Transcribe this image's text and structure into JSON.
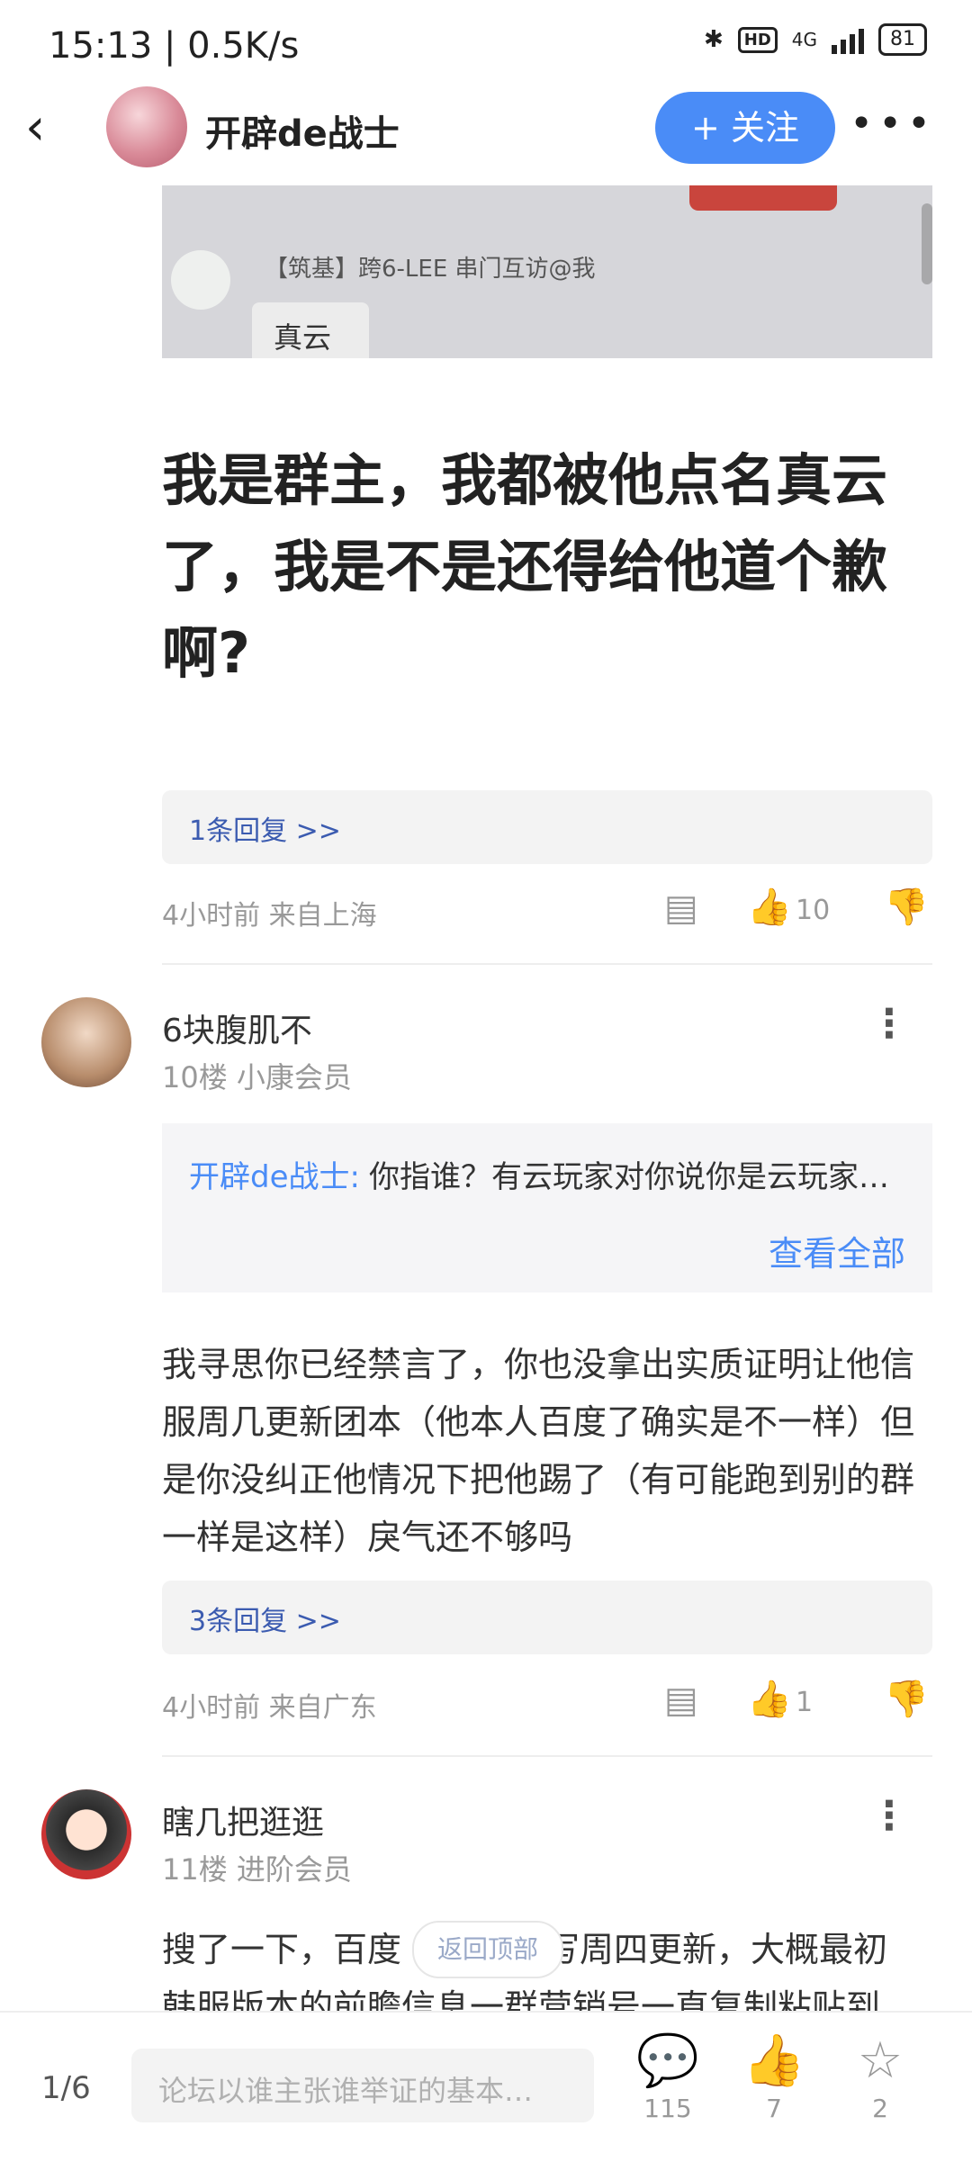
{
  "status": {
    "time": "15:13 | 0.5K/s",
    "bluetooth": "✱",
    "hd": "HD",
    "network": "4G",
    "battery": "81"
  },
  "header": {
    "author": "开辟de战士",
    "follow": "+ 关注"
  },
  "embed": {
    "text": "【筑基】跨6-LEE 串门互访@我",
    "bubble": "真云"
  },
  "post": {
    "title": "我是群主，我都被他点名真云了，我是不是还得给他道个歉啊?",
    "replies_link": "1条回复 >>",
    "meta": "4小时前 来自上海",
    "likes": "10"
  },
  "floor10": {
    "name": "6块腹肌不",
    "sub": "10楼 小康会员",
    "quote_name": "开辟de战士:",
    "quote_text": "你指谁？有云玩家对你说你是云玩家…",
    "quote_all": "查看全部",
    "content": "我寻思你已经禁言了，你也没拿出实质证明让他信服周几更新团本（他本人百度了确实是不一样）但是你没纠正他情况下把他踢了（有可能跑到别的群一样是这样）戾气还不够吗",
    "replies_link": "3条回复 >>",
    "meta": "4小时前 来自广东",
    "likes": "1"
  },
  "floor11": {
    "name": "瞎几把逛逛",
    "sub": "11楼 进阶会员",
    "content_line1_a": "搜了一下，百度",
    "content_line1_b": "写周四更新，大概最初",
    "content_line2": "韩服版本的前瞻信息一群营销号一直复制粘贴到"
  },
  "back_to_top": "返回顶部",
  "bottom": {
    "page": "1/6",
    "placeholder": "论坛以谁主张谁举证的基本…",
    "comments": "115",
    "likes": "7",
    "favorites": "2"
  }
}
